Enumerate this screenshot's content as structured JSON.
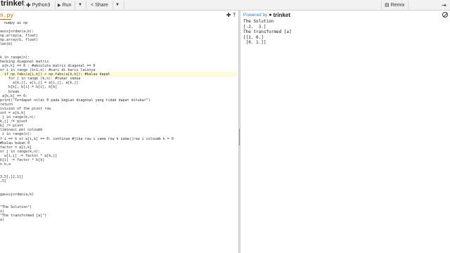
{
  "topbar": {
    "brand": "trinket",
    "python_label": "Python3",
    "run_label": "Run",
    "share_label": "Share",
    "remix_label": "Remix"
  },
  "editor": {
    "filename": "n.py",
    "lines": [
      "  numpy as np",
      "",
      "aussjordan(a,b):",
      "np.array(a, float)",
      "np.array(b, float)",
      "len(b)",
      "",
      "",
      "k in range(n):",
      "hecking diagonal matrix",
      " a[k,k] == 0 : #absolute matrix diagonal == 0",
      "or i in range (k+1,n): #cari di baris lainnya",
      "  if np.fabs(a[i,k]) > np.fabs(a[k,k]): #kalau dapat",
      "    for j in range (k,n): #tukar semua",
      "      a[k,j], a[i,j] = a[i,j], a[k,j]",
      "    b[k], b[i] = b[i], b[k]",
      "    break",
      " a[k,k] == 0:",
      "print(\"Terdapat nilai 0 pada bagian diagonal yang tidak dapat ditukar\")",
      "return",
      "ivision of the pivot row",
      "vot = a[k,k]",
      " j in range(k,n):",
      "k,j] /= pivot",
      "k] /= pivot",
      "liminasi per coloumb",
      " i in range(n):",
      "f i == k or a[i,k] == 0: continue #jika row i sama row k sama||row i coloumb k = 0",
      "#kalau bukan 0",
      "factor = a[i,k]",
      "or j in range(k,n):",
      "  a[i,j] -= factor * a[k,j]",
      "b[i] -= factor * b[k]",
      "n b,a",
      "",
      "",
      "3,5],[2,1]]",
      ",5]",
      "",
      "",
      "gaussjordan(a,b)",
      "",
      "",
      "\"The Solution\")",
      "x)",
      "\"The transformed [a]\")",
      "a)"
    ]
  },
  "output": {
    "powered_label": "Powered by",
    "powered_brand": "trinket",
    "text": "The Solution\n[-2.  3.]\nThe transformed [a]\n[[1. 0.]\n [0. 1.]]"
  }
}
